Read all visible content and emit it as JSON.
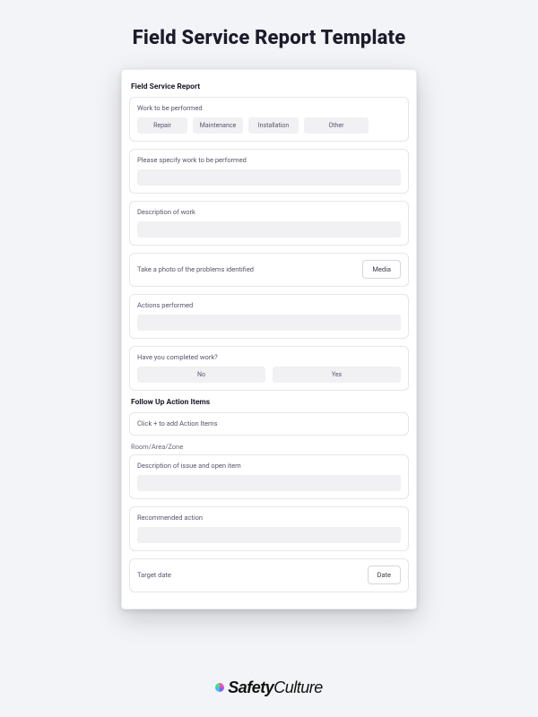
{
  "page": {
    "title": "Field Service Report Template"
  },
  "form": {
    "title": "Field Service Report",
    "work_to_be_performed": {
      "label": "Work to be performed",
      "options": [
        "Repair",
        "Maintenance",
        "Installation",
        "Other"
      ]
    },
    "specify_work": {
      "label": "Please specify work to be performed"
    },
    "description_of_work": {
      "label": "Description of work"
    },
    "photo": {
      "label": "Take a photo of the problems identified",
      "button": "Media"
    },
    "actions_performed": {
      "label": "Actions performed"
    },
    "completed_work": {
      "label": "Have you completed work?",
      "no": "No",
      "yes": "Yes"
    },
    "followup": {
      "title": "Follow Up Action Items",
      "add_hint": "Click + to add Action Items",
      "room_label": "Room/Area/Zone",
      "issue_desc": {
        "label": "Description of issue and open item"
      },
      "recommended_action": {
        "label": "Recommended action"
      },
      "target_date": {
        "label": "Target date",
        "button": "Date"
      }
    }
  },
  "brand": {
    "part1": "Safety",
    "part2": "Culture"
  }
}
